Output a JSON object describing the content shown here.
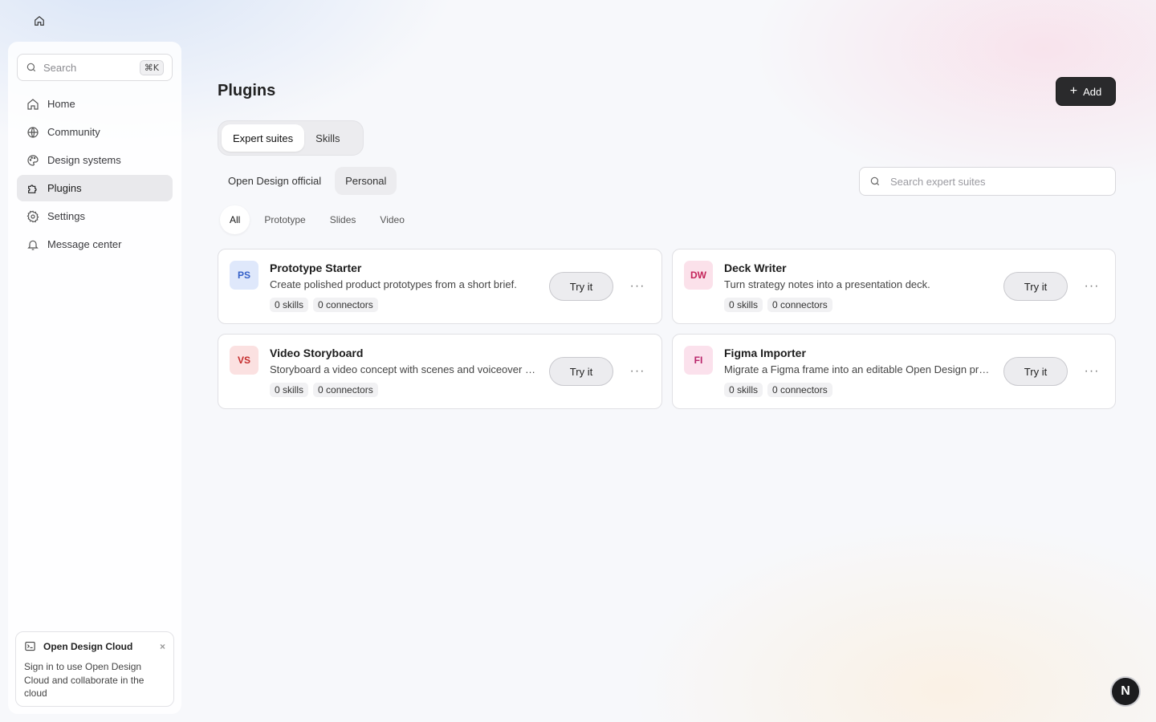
{
  "topbar": {
    "home_icon": "home-icon"
  },
  "sidebar": {
    "search": {
      "label": "Search",
      "shortcut": "⌘K"
    },
    "items": [
      {
        "label": "Home",
        "icon": "home-icon",
        "active": false
      },
      {
        "label": "Community",
        "icon": "globe-icon",
        "active": false
      },
      {
        "label": "Design systems",
        "icon": "palette-icon",
        "active": false
      },
      {
        "label": "Plugins",
        "icon": "puzzle-icon",
        "active": true
      },
      {
        "label": "Settings",
        "icon": "gear-icon",
        "active": false
      },
      {
        "label": "Message center",
        "icon": "bell-icon",
        "active": false
      }
    ],
    "cloud": {
      "title": "Open Design Cloud",
      "close": "×",
      "body": "Sign in to use Open Design Cloud and collaborate in the cloud"
    }
  },
  "main": {
    "title": "Plugins",
    "add_label": "Add",
    "segments": [
      {
        "label": "Expert suites",
        "active": true
      },
      {
        "label": "Skills",
        "active": false
      }
    ],
    "source_tabs": [
      {
        "label": "Open Design official",
        "active": false
      },
      {
        "label": "Personal",
        "active": true
      }
    ],
    "search_placeholder": "Search expert suites",
    "categories": [
      {
        "label": "All",
        "active": true
      },
      {
        "label": "Prototype",
        "active": false
      },
      {
        "label": "Slides",
        "active": false
      },
      {
        "label": "Video",
        "active": false
      }
    ],
    "cards": [
      {
        "initials": "PS",
        "title": "Prototype Starter",
        "desc": "Create polished product prototypes from a short brief.",
        "skills": "0 skills",
        "connectors": "0 connectors",
        "try_label": "Try it",
        "more": "···",
        "bg": "#dfe8fb",
        "fg": "#3460c8"
      },
      {
        "initials": "DW",
        "title": "Deck Writer",
        "desc": "Turn strategy notes into a presentation deck.",
        "skills": "0 skills",
        "connectors": "0 connectors",
        "try_label": "Try it",
        "more": "···",
        "bg": "#fbe1ea",
        "fg": "#c4245a"
      },
      {
        "initials": "VS",
        "title": "Video Storyboard",
        "desc": "Storyboard a video concept with scenes and voiceover notes.",
        "skills": "0 skills",
        "connectors": "0 connectors",
        "try_label": "Try it",
        "more": "···",
        "bg": "#fbe1e1",
        "fg": "#c42a2a"
      },
      {
        "initials": "FI",
        "title": "Figma Importer",
        "desc": "Migrate a Figma frame into an editable Open Design project.",
        "skills": "0 skills",
        "connectors": "0 connectors",
        "try_label": "Try it",
        "more": "···",
        "bg": "#fbe1ec",
        "fg": "#b8246a"
      }
    ]
  },
  "fab": {
    "label": "N"
  }
}
